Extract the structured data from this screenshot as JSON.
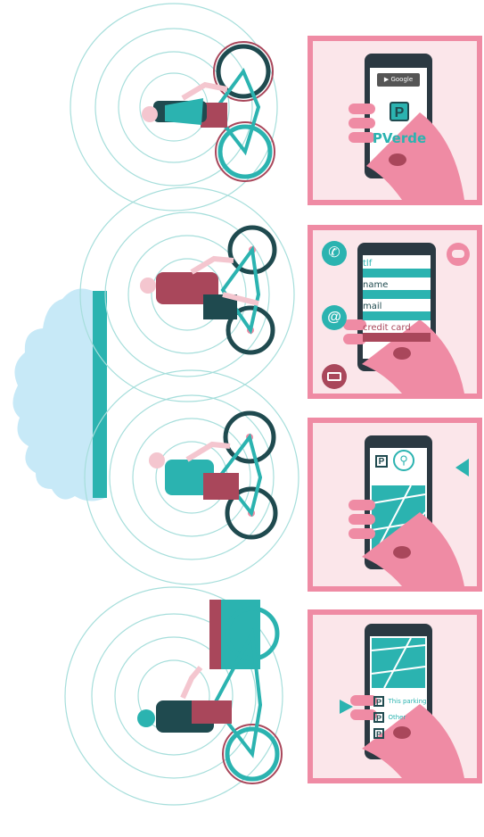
{
  "colors": {
    "teal": "#2bb3b0",
    "dark_teal": "#1f4a4f",
    "pink": "#ef8ba4",
    "light_pink": "#fbe6ea",
    "maroon": "#a9475b",
    "sky": "#c7e9f7",
    "phone": "#2b3942"
  },
  "panel1": {
    "store_badge": "Google play",
    "app_name": "PVerde",
    "app_icon": "parking-p-icon"
  },
  "panel2": {
    "fields": [
      "tlf",
      "name",
      "mail",
      "credit card"
    ],
    "icons": [
      "phone-call-icon",
      "at-sign-icon",
      "credit-card-icon",
      "speech-bubble-icon"
    ]
  },
  "panel3": {
    "icons": [
      "parking-p-icon",
      "bicycle-icon",
      "map-icon",
      "arrow-left-icon"
    ]
  },
  "panel4": {
    "options": [
      "This parking",
      "Other"
    ],
    "icons": [
      "map-icon",
      "arrow-right-icon",
      "parking-p-icon"
    ]
  },
  "scene": {
    "icons": [
      "cloud-icon",
      "cyclist-icon",
      "signal-rings-icon"
    ]
  }
}
